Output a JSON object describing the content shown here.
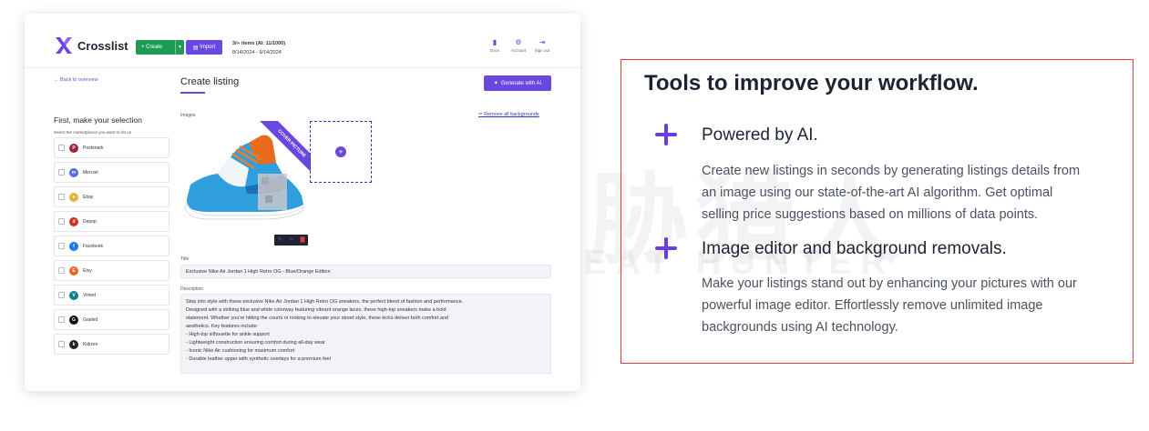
{
  "app": {
    "logo_text": "Crosslist",
    "create_label": "+ Create",
    "import_label": "Import",
    "items_line": "3/∞ items (AI: 11/1000)",
    "date_range": "8/14/2024 - 9/14/2024",
    "top_actions": [
      {
        "label": "Docs",
        "icon": "doc-icon"
      },
      {
        "label": "Account",
        "icon": "gear-icon"
      },
      {
        "label": "Sign out",
        "icon": "sign-out-icon"
      }
    ],
    "back_link": "← Back to overview",
    "page_title": "Create listing",
    "generate_ai_label": "Generate with AI",
    "marketplaces": {
      "heading": "First, make your selection",
      "subheading": "Select the marketplaces you want to list on",
      "items": [
        {
          "name": "Poshmark",
          "color": "#a3233a",
          "glyph": "P"
        },
        {
          "name": "Mercari",
          "color": "#4f6ee6",
          "glyph": "m"
        },
        {
          "name": "Ebay",
          "color": "#e4b33b",
          "glyph": "e"
        },
        {
          "name": "Depop",
          "color": "#d12f1b",
          "glyph": "d"
        },
        {
          "name": "Facebook",
          "color": "#1877f2",
          "glyph": "f"
        },
        {
          "name": "Etsy",
          "color": "#f1641e",
          "glyph": "E"
        },
        {
          "name": "Vinted",
          "color": "#0b7f8a",
          "glyph": "V"
        },
        {
          "name": "Grailed",
          "color": "#111111",
          "glyph": "G"
        },
        {
          "name": "Kidizen",
          "color": "#1f2430",
          "glyph": "k"
        }
      ]
    },
    "images_label": "Images",
    "remove_bg_label": "Remove all backgrounds",
    "cover_label": "COVER PICTURE",
    "title_label": "Title",
    "title_value": "Exclusive Nike Air Jordan 1 High Retro OG - Blue/Orange Edition",
    "description_label": "Description",
    "description_lines": [
      "Step into style with these exclusive Nike Air Jordan 1 High Retro OG sneakers, the perfect blend of fashion and performance.",
      "Designed with a striking blue and white colorway featuring vibrant orange laces, these high-top sneakers make a bold",
      "statement. Whether you're hitting the courts or looking to elevate your street style, these kicks deliver both comfort and",
      "aesthetics. Key features include:",
      "- High-top silhouette for ankle support",
      "- Lightweight construction ensuring comfort during all-day wear",
      "- Iconic Nike Air cushioning for maximum comfort",
      "- Durable leather upper with synthetic overlays for a premium feel"
    ]
  },
  "watermark": {
    "text": "威胁猎人",
    "sub": "THREAT HUNTER"
  },
  "panel": {
    "heading": "Tools to improve your workflow.",
    "features": [
      {
        "title": "Powered by AI.",
        "desc_lines": [
          "Create new listings in seconds by generating listings details from",
          "an image using our state-of-the-art AI algorithm. Get optimal",
          "selling price suggestions based on millions of data points."
        ]
      },
      {
        "title": "Image editor and background removals.",
        "desc_lines": [
          "Make your listings stand out by enhancing your pictures with our",
          "powerful image editor. Effortlessly remove unlimited image",
          "backgrounds using AI technology."
        ]
      }
    ],
    "accent_color": "#6a3de0",
    "border_color": "#e23c3c"
  }
}
